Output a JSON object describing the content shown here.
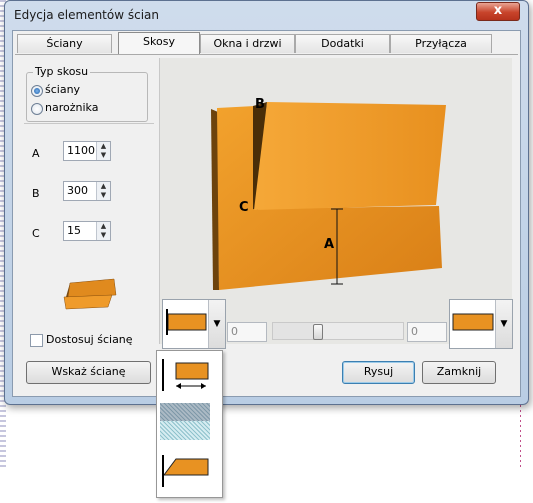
{
  "window": {
    "title": "Edycja elementów ścian",
    "close_glyph": "x"
  },
  "tabs": [
    {
      "label": "Ściany"
    },
    {
      "label": "Skosy",
      "active": true
    },
    {
      "label": "Okna i drzwi"
    },
    {
      "label": "Dodatki"
    },
    {
      "label": "Przyłącza"
    }
  ],
  "bevel_type": {
    "group_label": "Typ skosu",
    "options": [
      {
        "label": "ściany",
        "selected": true
      },
      {
        "label": "narożnika",
        "selected": false
      }
    ]
  },
  "params": [
    {
      "label": "A",
      "value": "1100"
    },
    {
      "label": "B",
      "value": "300"
    },
    {
      "label": "C",
      "value": "15"
    }
  ],
  "adjust_wall": {
    "label": "Dostosuj ścianę",
    "checked": false
  },
  "diagram_labels": {
    "a": "A",
    "b": "B",
    "c": "C"
  },
  "left_offset_value": "0",
  "right_offset_value": "0",
  "slider_level": 0.33,
  "buttons": {
    "show_wall": "Wskaż ścianę",
    "draw": "Rysuj",
    "close": "Zamknij"
  },
  "colors": {
    "wall_orange": "#e08a1e",
    "accent_blue": "#3c7fb1"
  },
  "icons": {
    "spin_up": "▲",
    "spin_down": "▼",
    "combo_arrow": "▼"
  }
}
